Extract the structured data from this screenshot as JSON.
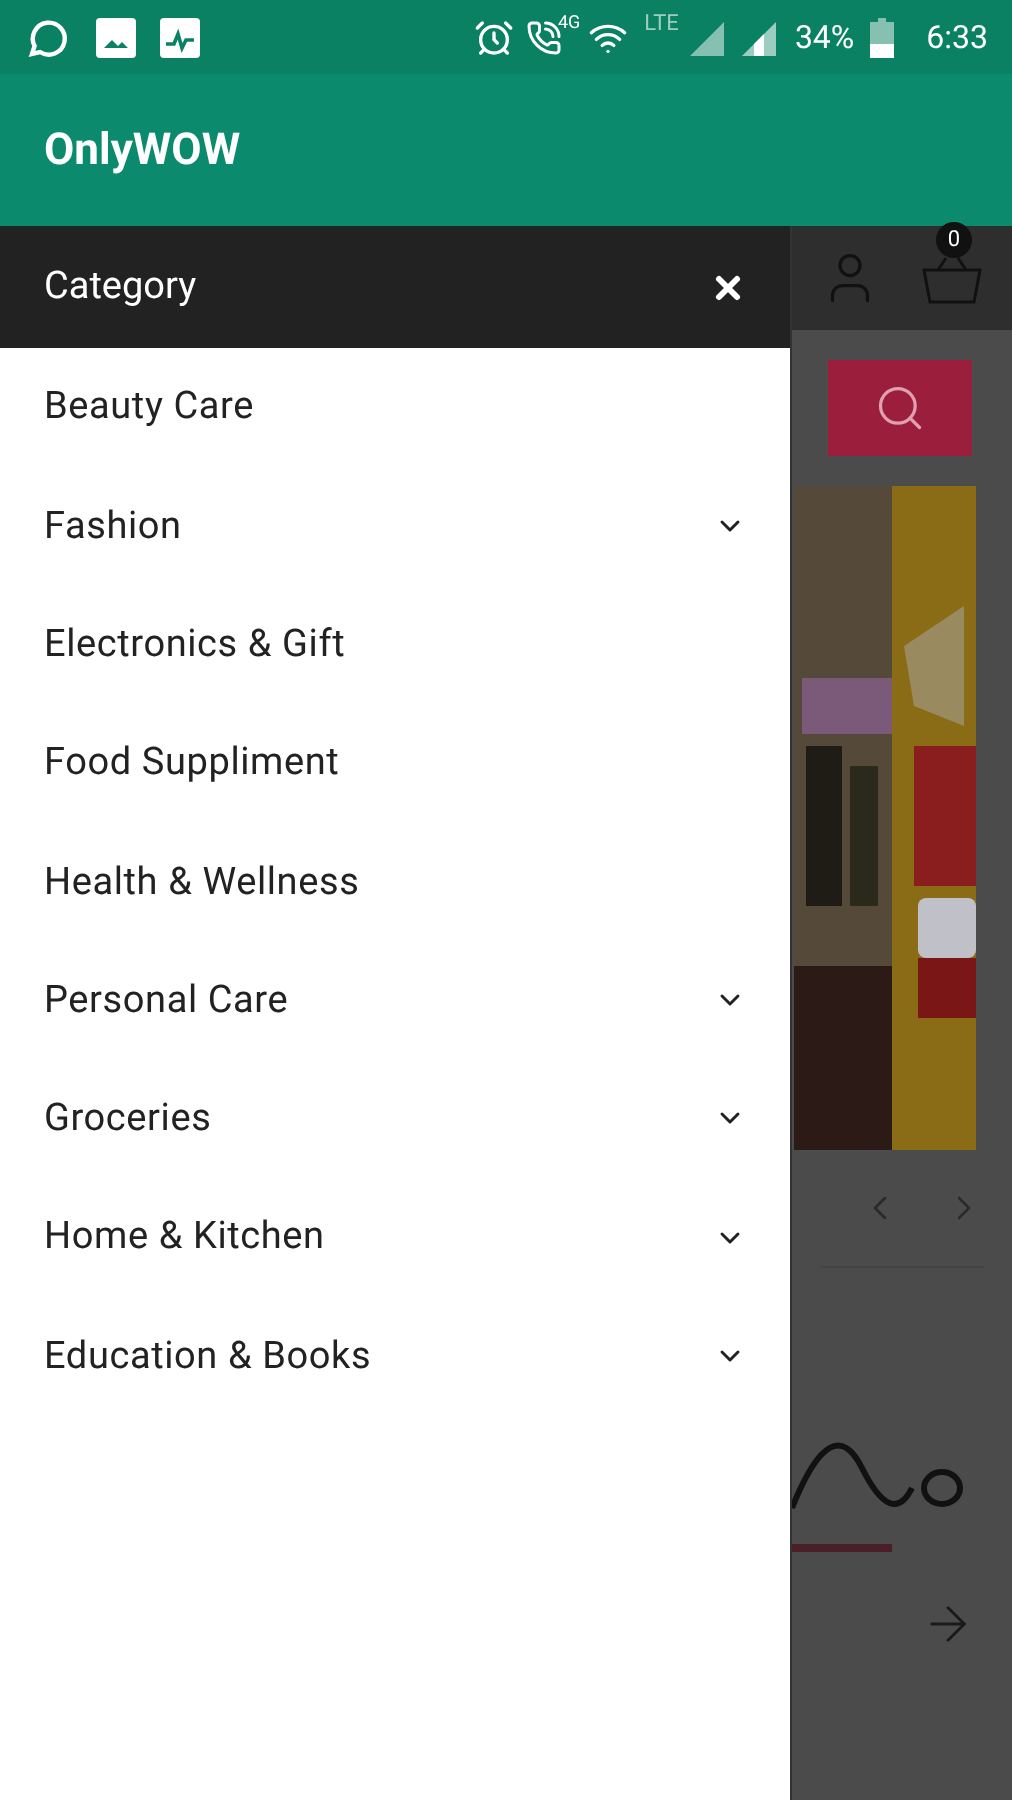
{
  "status_bar": {
    "network": "4G",
    "lte": "LTE",
    "battery": "34%",
    "time": "6:33"
  },
  "app_bar": {
    "title": "OnlyWOW"
  },
  "drawer": {
    "title": "Category",
    "items": [
      {
        "label": "Beauty Care",
        "has_children": false
      },
      {
        "label": "Fashion",
        "has_children": true
      },
      {
        "label": "Electronics & Gift",
        "has_children": false
      },
      {
        "label": "Food Suppliment",
        "has_children": false
      },
      {
        "label": "Health & Wellness",
        "has_children": false
      },
      {
        "label": "Personal Care",
        "has_children": true
      },
      {
        "label": "Groceries",
        "has_children": true
      },
      {
        "label": "Home & Kitchen",
        "has_children": true
      },
      {
        "label": "Education & Books",
        "has_children": true
      }
    ]
  },
  "page_behind": {
    "cart_count": "0"
  }
}
